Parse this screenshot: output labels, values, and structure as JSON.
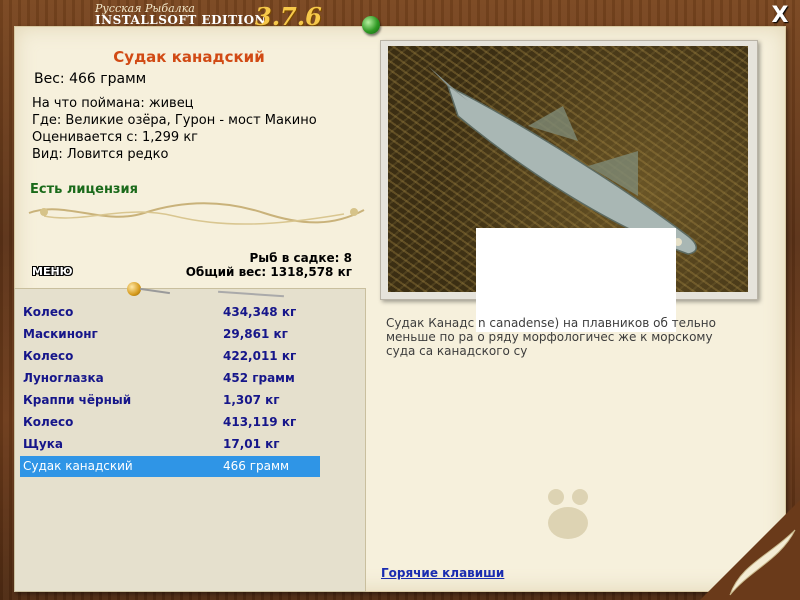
{
  "header": {
    "game_title_line1": "Русская Рыбалка",
    "game_title_line2": "INSTALLSOFT EDITION",
    "version": "3.7.6",
    "close_label": "X"
  },
  "fish": {
    "name": "Судак канадский",
    "weight": "Вес: 466 грамм",
    "caught_with": "На что поймана: живец",
    "location": "Где: Великие озёра, Гурон - мост Макино",
    "valued_from": "Оценивается с: 1,299 кг",
    "kind": "Вид: Ловится редко",
    "license": "Есть лицензия",
    "description": "Судак Канадс                                         n canadense) на                                              плавников об                                            тельно меньше по ра                                       о ряду морфологичес                                     же к морскому суда                                   са канадского су"
  },
  "stats": {
    "fish_in_keepnet": "Рыб в садке: 8",
    "total_weight": "Общий вес: 1318,578 кг"
  },
  "menu_label": "МЕНЮ",
  "catch_list": [
    {
      "name": "Колесо",
      "weight": "434,348 кг"
    },
    {
      "name": "Маскинонг",
      "weight": "29,861 кг"
    },
    {
      "name": "Колесо",
      "weight": "422,011 кг"
    },
    {
      "name": "Луноглазка",
      "weight": "452 грамм"
    },
    {
      "name": "Краппи чёрный",
      "weight": "1,307 кг"
    },
    {
      "name": "Колесо",
      "weight": "413,119 кг"
    },
    {
      "name": "Щука",
      "weight": "17,01 кг"
    },
    {
      "name": "Судак канадский",
      "weight": "466 грамм",
      "selected": true
    }
  ],
  "hotkeys_link": "Горячие клавиши",
  "colors": {
    "title_red": "#d14a14",
    "license_green": "#1a6a1a",
    "list_text_blue": "#16168a",
    "selection_blue": "#2f95e6",
    "link_blue": "#1a2cb0"
  }
}
